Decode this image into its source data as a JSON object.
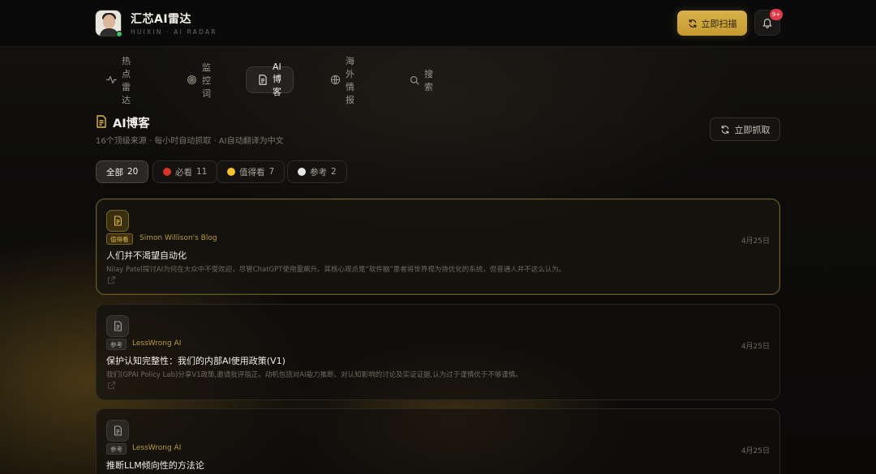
{
  "header": {
    "app_title": "汇芯AI雷达",
    "app_subtitle": "HUIXIN · AI RADAR",
    "scan_label": "立即扫描",
    "notification_badge": "9+"
  },
  "tabs": [
    {
      "label": "热点雷达",
      "icon": "pulse-icon",
      "active": false
    },
    {
      "label": "监控词",
      "icon": "target-icon",
      "active": false
    },
    {
      "label": "AI博客",
      "icon": "document-icon",
      "active": true
    },
    {
      "label": "海外情报",
      "icon": "globe-icon",
      "active": false
    },
    {
      "label": "搜索",
      "icon": "search-icon",
      "active": false
    }
  ],
  "section": {
    "title": "AI博客",
    "subtitle": "16个顶级来源 · 每小时自动抓取 · AI自动翻译为中文",
    "fetch_label": "立即抓取"
  },
  "filters": [
    {
      "label": "全部",
      "count": "20",
      "active": true
    },
    {
      "label": "必看",
      "count": "11",
      "dot": "#d9342b"
    },
    {
      "label": "值得看",
      "count": "7",
      "dot": "#f2c230"
    },
    {
      "label": "参考",
      "count": "2",
      "dot": "#e6e6e6"
    }
  ],
  "cards": [
    {
      "tag": "值得看",
      "source": "Simon Willison's Blog",
      "date": "4月25日",
      "title": "人们并不渴望自动化",
      "description": "Nilay Patel探讨AI为何在大众中不受欢迎，尽管ChatGPT使用量飙升。其核心观点是“软件脑”患者将世界视为待优化的系统，但普通人并不这么认为。"
    },
    {
      "tag": "参考",
      "source": "LessWrong AI",
      "date": "4月25日",
      "title": "保护认知完整性：我们的内部AI使用政策(V1)",
      "description": "我们(GPAI Policy Lab)分享V1政策,邀请批评指正。动机包括对AI能力推断、对认知影响的讨论及实证证据,认为过于谨慎优于不够谨慎。"
    },
    {
      "tag": "参考",
      "source": "LessWrong AI",
      "date": "4月25日",
      "title": "推断LLM倾向性的方法论",
      "description": ""
    }
  ],
  "colors": {
    "accent_gold": "#d7b24a",
    "badge_red": "#e0394a",
    "online_green": "#3fbf6a"
  }
}
